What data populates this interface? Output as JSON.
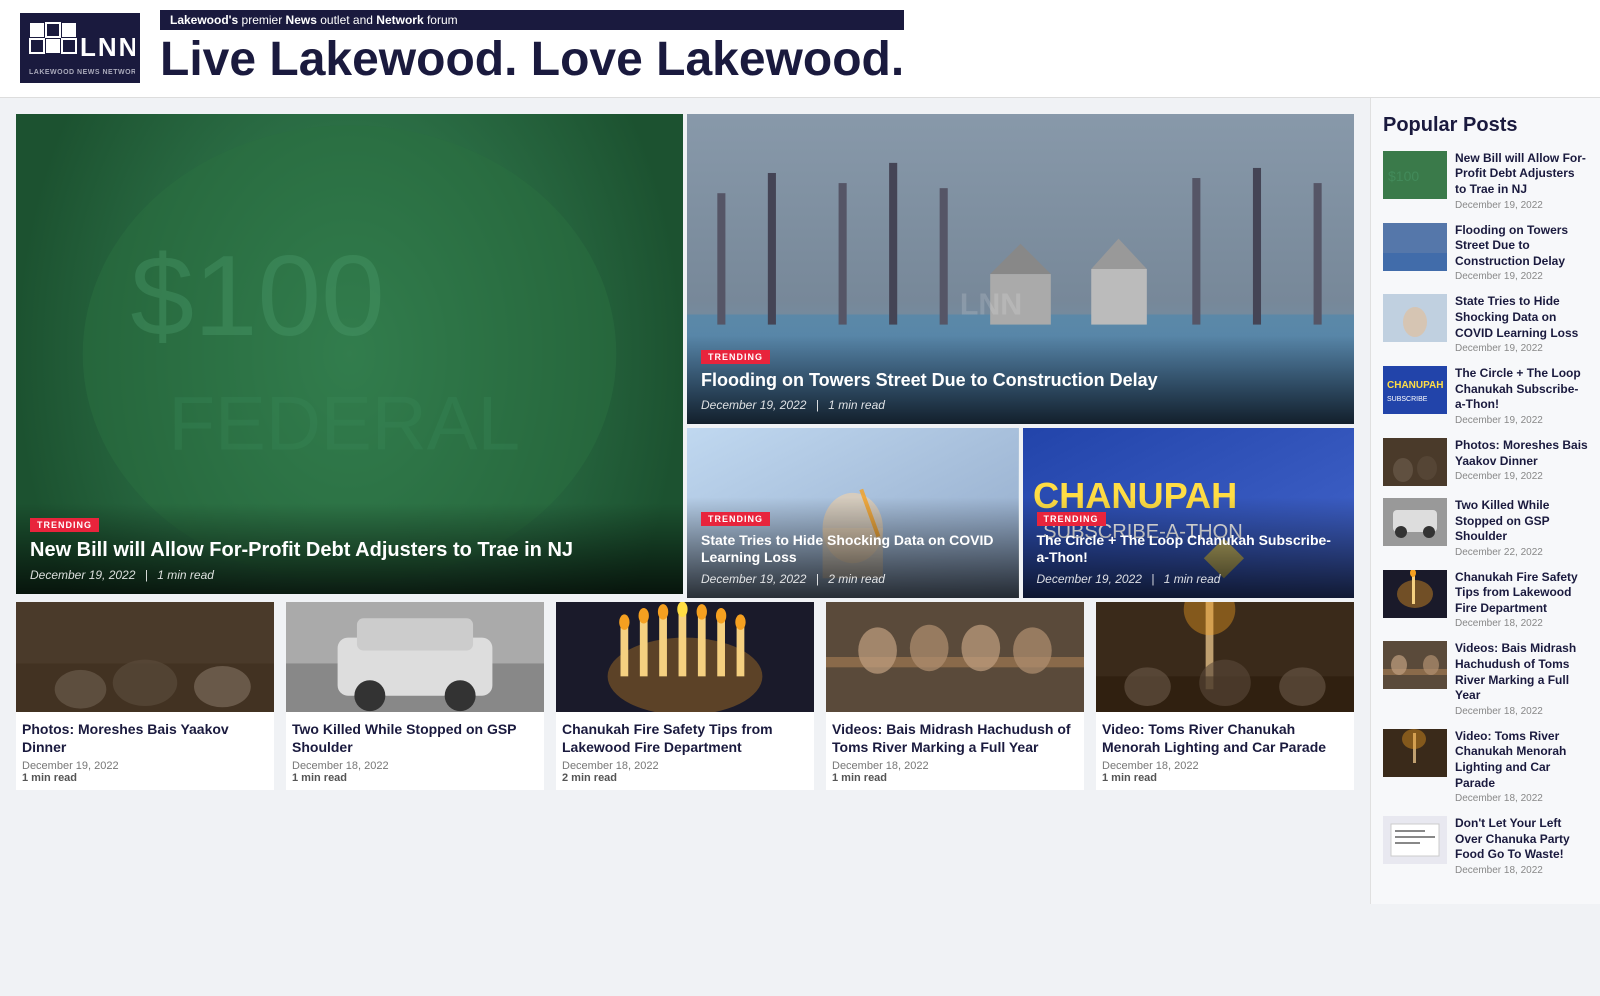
{
  "header": {
    "logo_text": "LNN",
    "logo_subtext": "LAKEWOOD NEWS NETWORK",
    "tagline_banner": "Lakewood's premier News outlet and Network forum",
    "main_tagline": "Live Lakewood. Love Lakewood."
  },
  "featured_left": {
    "badge": "TRENDING",
    "title": "New Bill will Allow For-Profit Debt Adjusters to Trae in NJ",
    "date": "December 19, 2022",
    "read_time": "1 min read"
  },
  "featured_right_top": {
    "badge": "TRENDING",
    "title": "Flooding on Towers Street Due to Construction Delay",
    "date": "December 19, 2022",
    "read_time": "1 min read"
  },
  "featured_right_bottom": [
    {
      "badge": "TRENDING",
      "title": "State Tries to Hide Shocking Data on COVID Learning Loss",
      "date": "December 19, 2022",
      "read_time": "2 min read"
    },
    {
      "badge": "TRENDING",
      "title": "The Circle + The Loop Chanukah Subscribe-a-Thon!",
      "date": "December 19, 2022",
      "read_time": "1 min read"
    }
  ],
  "bottom_cards": [
    {
      "title": "Photos: Moreshes Bais Yaakov Dinner",
      "date": "December 19, 2022",
      "read_time": "1 min read"
    },
    {
      "title": "Two Killed While Stopped on GSP Shoulder",
      "date": "December 18, 2022",
      "read_time": "1 min read"
    },
    {
      "title": "Chanukah Fire Safety Tips from Lakewood Fire Department",
      "date": "December 18, 2022",
      "read_time": "2 min read"
    },
    {
      "title": "Videos: Bais Midrash Hachudush of Toms River Marking a Full Year",
      "date": "December 18, 2022",
      "read_time": "1 min read"
    },
    {
      "title": "Video: Toms River Chanukah Menorah Lighting and Car Parade",
      "date": "December 18, 2022",
      "read_time": "1 min read"
    }
  ],
  "sidebar": {
    "title": "Popular Posts",
    "items": [
      {
        "title": "New Bill will Allow For-Profit Debt Adjusters to Trae in NJ",
        "date": "December 19, 2022"
      },
      {
        "title": "Flooding on Towers Street Due to Construction Delay",
        "date": "December 19, 2022"
      },
      {
        "title": "State Tries to Hide Shocking Data on COVID Learning Loss",
        "date": "December 19, 2022"
      },
      {
        "title": "The Circle + The Loop Chanukah Subscribe-a-Thon!",
        "date": "December 19, 2022"
      },
      {
        "title": "Photos: Moreshes Bais Yaakov Dinner",
        "date": "December 19, 2022"
      },
      {
        "title": "Two Killed While Stopped on GSP Shoulder",
        "date": "December 22, 2022"
      },
      {
        "title": "Chanukah Fire Safety Tips from Lakewood Fire Department",
        "date": "December 18, 2022"
      },
      {
        "title": "Videos: Bais Midrash Hachudush of Toms River Marking a Full Year",
        "date": "December 18, 2022"
      },
      {
        "title": "Video: Toms River Chanukah Menorah Lighting and Car Parade",
        "date": "December 18, 2022"
      },
      {
        "title": "Don't Let Your Left Over Chanuka Party Food Go To Waste!",
        "date": "December 18, 2022"
      }
    ]
  }
}
